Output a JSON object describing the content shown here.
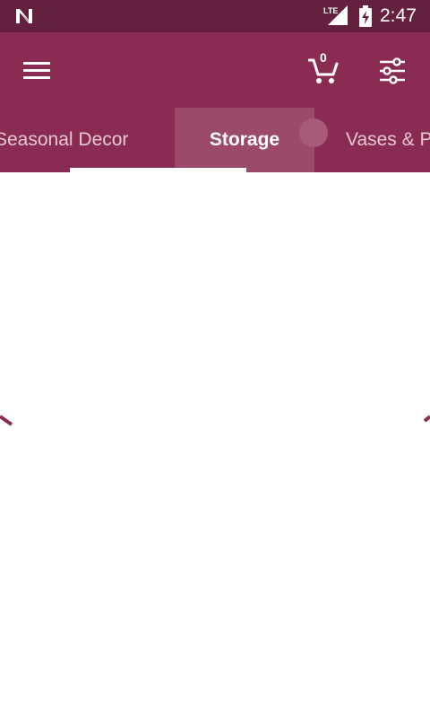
{
  "status_bar": {
    "time": "2:47",
    "network": "LTE",
    "background_color": "#63213f"
  },
  "app_bar": {
    "background_color": "#892b52",
    "menu_icon": "hamburger-menu-icon",
    "cart_icon": "shopping-cart-icon",
    "cart_count": "0",
    "filter_icon": "sliders-icon"
  },
  "tabs": {
    "items": [
      {
        "label": "Seasonal Decor",
        "selected": false
      },
      {
        "label": "Storage",
        "selected": true
      },
      {
        "label": "Vases & Planters",
        "selected": false
      }
    ],
    "indicator_color": "#ffffff",
    "selected_color": "#ffffff",
    "unselected_color": "#e6c8d5"
  },
  "content": {
    "state": "loading",
    "spinner_color": "#892b52"
  }
}
